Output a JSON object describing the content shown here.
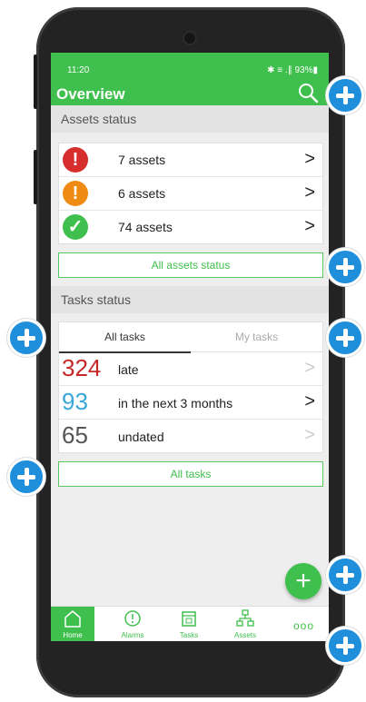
{
  "status_bar": {
    "time": "11:20",
    "system_icons": "✱ ≡ .∥ 93%▮"
  },
  "app_bar": {
    "title": "Overview",
    "search_icon": "search-icon"
  },
  "assets_section": {
    "header": "Assets status",
    "rows": [
      {
        "label": "7 assets",
        "icon": "alert-icon",
        "color": "#d62d2d",
        "glyph": "!"
      },
      {
        "label": "6 assets",
        "icon": "warning-icon",
        "color": "#ef8a12",
        "glyph": "!"
      },
      {
        "label": "74 assets",
        "icon": "check-icon",
        "color": "#3fbf4d",
        "glyph": "✓"
      }
    ],
    "all_button": "All assets status"
  },
  "tasks_section": {
    "header": "Tasks status",
    "tabs": [
      {
        "label": "All tasks",
        "active": true
      },
      {
        "label": "My tasks",
        "active": false
      }
    ],
    "rows": [
      {
        "count": "324",
        "label": "late",
        "color": "#c62828"
      },
      {
        "count": "93",
        "label": "in the next 3 months",
        "color": "#3aa6d9"
      },
      {
        "count": "65",
        "label": "undated",
        "color": "#555555"
      }
    ],
    "all_button": "All tasks"
  },
  "fab": {
    "label": "+"
  },
  "bottom_nav": {
    "items": [
      {
        "label": "Home",
        "icon": "home-icon",
        "active": true
      },
      {
        "label": "Alarms",
        "icon": "alarm-icon",
        "active": false
      },
      {
        "label": "Tasks",
        "icon": "calendar-icon",
        "active": false
      },
      {
        "label": "Assets",
        "icon": "hierarchy-icon",
        "active": false
      }
    ],
    "more": "ooo"
  },
  "colors": {
    "primary": "#3fbf4d",
    "callout": "#1f8fdc"
  }
}
